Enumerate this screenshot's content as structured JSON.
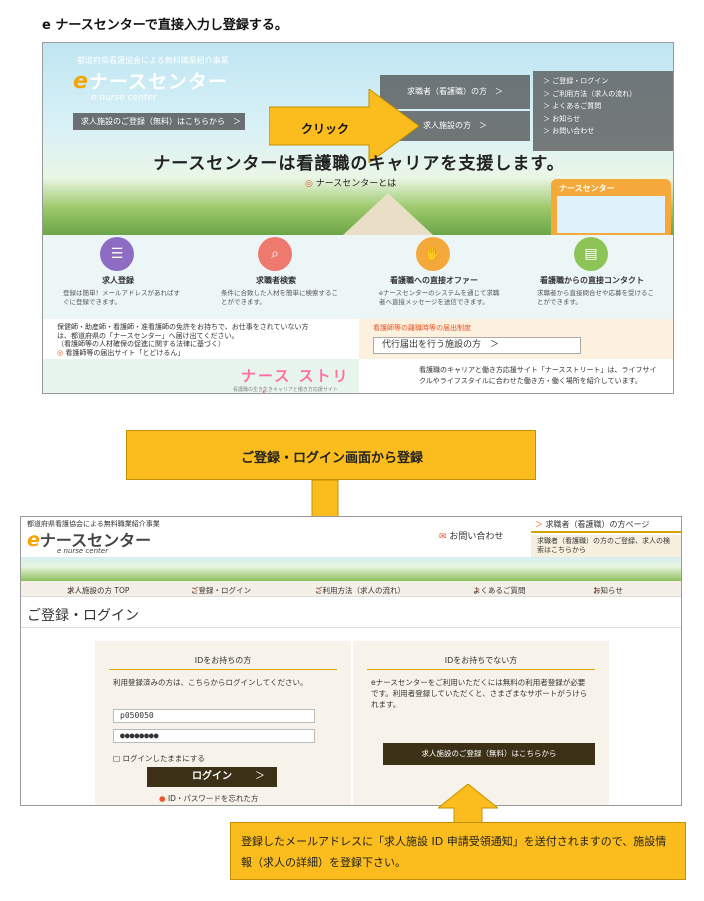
{
  "heading": "e ナースセンターで直接入力し登録する。",
  "top_page": {
    "association": "都道府県看護協会による無料職業紹介事業",
    "logo": "ナースセンター",
    "logo_e": "e",
    "logo_sub": "e nurse center",
    "register_button": "求人施設のご登録（無料）はこちらから　＞",
    "role_jobseeker": "求職者（看護職）の方　＞",
    "role_facility": "求人施設の方　＞",
    "menu": [
      "＞ ご登録・ログイン",
      "＞ ご利用方法（求人の流れ）",
      "＞ よくあるご質問",
      "＞ お知らせ",
      "＞ お問い合わせ"
    ],
    "click_label": "クリック",
    "catchphrase": "ナースセンターは看護職のキャリアを支援します。",
    "about_dot": "◎",
    "about": "ナースセンターとは",
    "video_label": "ナースセンター",
    "features": [
      {
        "icon": "list-icon",
        "glyph": "☰",
        "color": "#8e6cc4",
        "title": "求人登録",
        "desc": "登録は簡単！メールアドレスがあればすぐに登録できます。"
      },
      {
        "icon": "search-person-icon",
        "glyph": "⌕",
        "color": "#ee7a6f",
        "title": "求職者検索",
        "desc": "条件に合致した人材を簡単に検索することができます。"
      },
      {
        "icon": "handshake-icon",
        "glyph": "✋",
        "color": "#f6a93b",
        "title": "看護職への直接オファー",
        "desc": "eナースセンターのシステムを通じて求職者へ直接メッセージを送信できます。"
      },
      {
        "icon": "id-card-icon",
        "glyph": "▤",
        "color": "#8cc556",
        "title": "看護職からの直接コンタクト",
        "desc": "求職者から直接問合せや応募を受けることができます。"
      }
    ],
    "notice_lines": [
      "保健師・助産師・看護師・准看護師の免許をお持ちで、お仕事をされていない方",
      "は、都道府県の「ナースセンター」へ届け出てください。",
      "（看護師等の人材確保の促進に関する法律に基づく）"
    ],
    "notice_link_dot": "◎",
    "notice_link": "看護師等の届出サイト「とどけるん」",
    "report_heading": "看護師等の離職時等の届出制度",
    "report_button": "代行届出を行う施設の方　＞",
    "street_logo": "ナース ストリート",
    "street_sub": "看護職の生き生きキャリアと働き方応援サイト",
    "street_desc": "看護職のキャリアと働き方応援サイト「ナースストリート」は、ライフサイクルやライフスタイルに合わせた働き方・働く場所を紹介しています。"
  },
  "middle_callout": "ご登録・ログイン画面から登録",
  "login_page": {
    "association": "都道府県看護協会による無料職業紹介事業",
    "logo": "ナースセンター",
    "logo_e": "e",
    "logo_sub": "e nurse center",
    "contact": "お問い合わせ",
    "job_link": "求職者（看護職）の方ページ",
    "job_note": "求職者（看護職）の方のご登録、求人の検索はこちらから",
    "nav": [
      "求人施設の方 TOP",
      "ご登録・ログイン",
      "ご利用方法（求人の流れ）",
      "よくあるご質問",
      "お知らせ"
    ],
    "title": "ご登録・ログイン",
    "left_panel": {
      "heading": "IDをお持ちの方",
      "desc": "利用登録済みの方は、こちらからログインしてください。",
      "id_value": "p050050",
      "password_value": "●●●●●●●●",
      "keep_login": "□ ログインしたままにする",
      "login_button": "ログイン",
      "forgot_dot": "●",
      "forgot": "ID・パスワードを忘れた方"
    },
    "right_panel": {
      "heading": "IDをお持ちでない方",
      "desc": "eナースセンターをご利用いただくには無料の利用者登録が必要です。利用者登録していただくと、さまざまなサポートがうけられます。",
      "register_button": "求人施設のご登録（無料）はこちらから"
    }
  },
  "bottom_callout": "登録したメールアドレスに「求人施設 ID 申請受領通知」を送付されますので、施設情報（求人の詳細）を登録下さい。",
  "colors": {
    "callout": "#fbbd1e",
    "dark_button": "#3c3016",
    "accent": "#e8562a"
  }
}
